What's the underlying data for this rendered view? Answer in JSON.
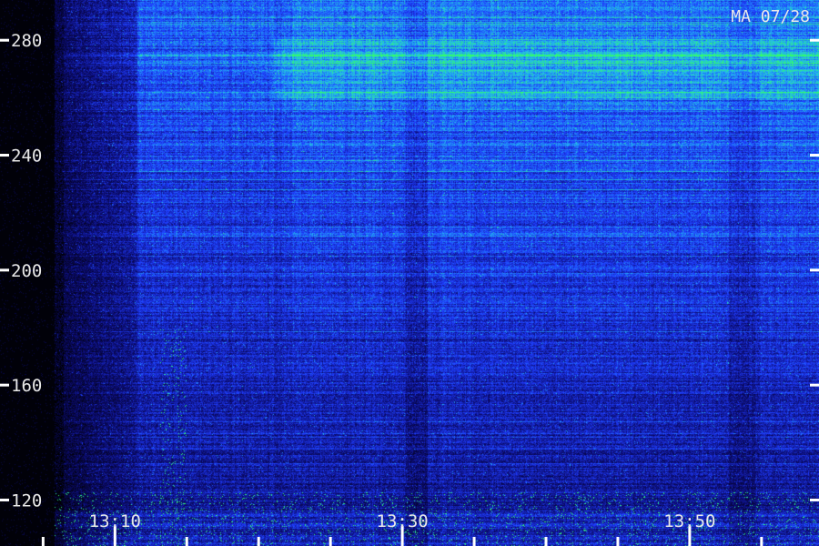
{
  "chart_data": {
    "type": "heatmap",
    "title": "",
    "stamp": "MA 07/28",
    "xlabel": "",
    "ylabel": "",
    "y_ticks": [
      {
        "value": 120,
        "label": "120"
      },
      {
        "value": 160,
        "label": "160"
      },
      {
        "value": 200,
        "label": "200"
      },
      {
        "value": 240,
        "label": "240"
      },
      {
        "value": 280,
        "label": "280"
      }
    ],
    "ylim": [
      104,
      294
    ],
    "x_time_start": "13:02",
    "x_time_end": "13:59",
    "x_ticks": [
      {
        "time": "13:10",
        "label": "13:10"
      },
      {
        "time": "13:30",
        "label": "13:30"
      },
      {
        "time": "13:50",
        "label": "13:50"
      }
    ],
    "x_minor_tick_interval_min": 5,
    "colormap": [
      "#000000",
      "#0b0b6e",
      "#1f3dff",
      "#22b8f0",
      "#33ff66"
    ],
    "grid": false
  }
}
